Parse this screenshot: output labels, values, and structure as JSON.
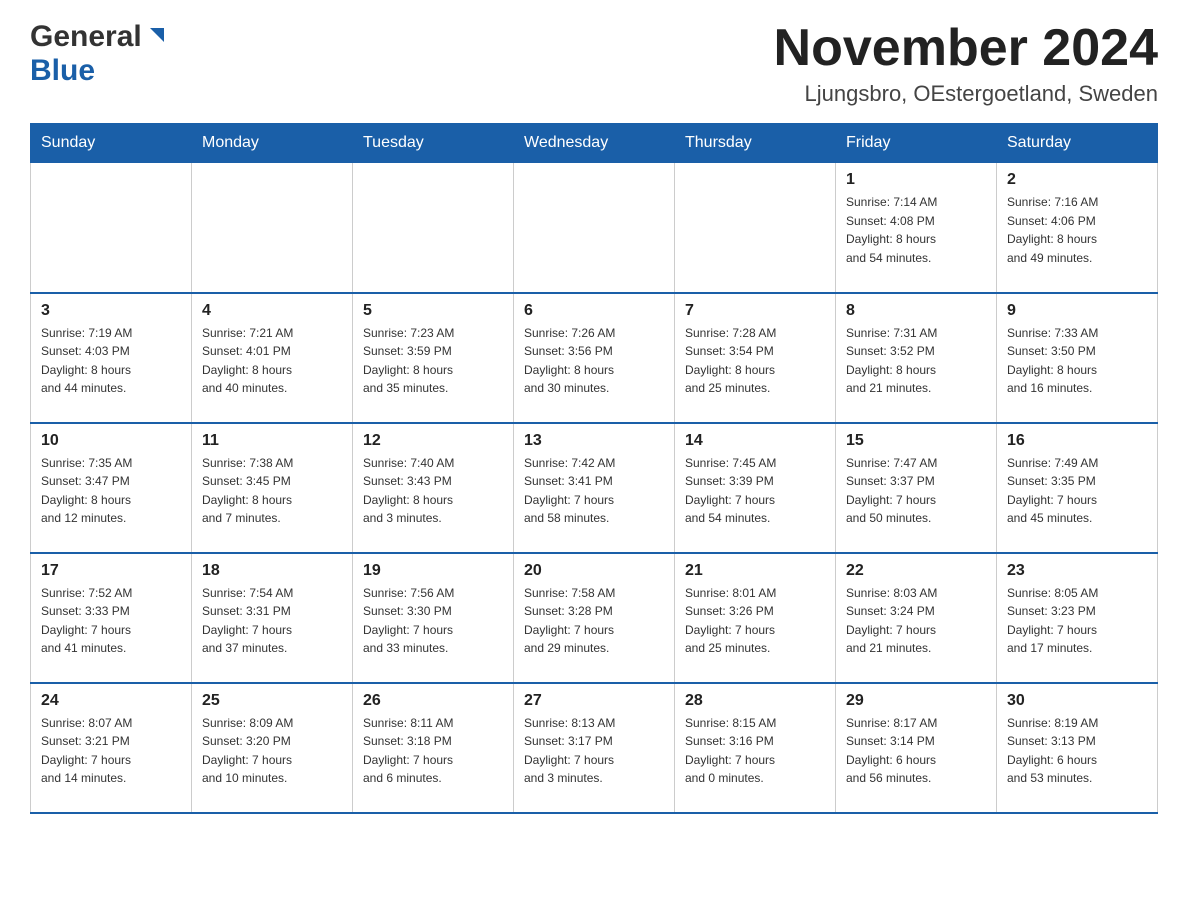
{
  "header": {
    "logo_general": "General",
    "logo_blue": "Blue",
    "month_title": "November 2024",
    "location": "Ljungsbro, OEstergoetland, Sweden"
  },
  "calendar": {
    "days_of_week": [
      "Sunday",
      "Monday",
      "Tuesday",
      "Wednesday",
      "Thursday",
      "Friday",
      "Saturday"
    ],
    "weeks": [
      {
        "days": [
          {
            "number": "",
            "info": ""
          },
          {
            "number": "",
            "info": ""
          },
          {
            "number": "",
            "info": ""
          },
          {
            "number": "",
            "info": ""
          },
          {
            "number": "",
            "info": ""
          },
          {
            "number": "1",
            "info": "Sunrise: 7:14 AM\nSunset: 4:08 PM\nDaylight: 8 hours\nand 54 minutes."
          },
          {
            "number": "2",
            "info": "Sunrise: 7:16 AM\nSunset: 4:06 PM\nDaylight: 8 hours\nand 49 minutes."
          }
        ]
      },
      {
        "days": [
          {
            "number": "3",
            "info": "Sunrise: 7:19 AM\nSunset: 4:03 PM\nDaylight: 8 hours\nand 44 minutes."
          },
          {
            "number": "4",
            "info": "Sunrise: 7:21 AM\nSunset: 4:01 PM\nDaylight: 8 hours\nand 40 minutes."
          },
          {
            "number": "5",
            "info": "Sunrise: 7:23 AM\nSunset: 3:59 PM\nDaylight: 8 hours\nand 35 minutes."
          },
          {
            "number": "6",
            "info": "Sunrise: 7:26 AM\nSunset: 3:56 PM\nDaylight: 8 hours\nand 30 minutes."
          },
          {
            "number": "7",
            "info": "Sunrise: 7:28 AM\nSunset: 3:54 PM\nDaylight: 8 hours\nand 25 minutes."
          },
          {
            "number": "8",
            "info": "Sunrise: 7:31 AM\nSunset: 3:52 PM\nDaylight: 8 hours\nand 21 minutes."
          },
          {
            "number": "9",
            "info": "Sunrise: 7:33 AM\nSunset: 3:50 PM\nDaylight: 8 hours\nand 16 minutes."
          }
        ]
      },
      {
        "days": [
          {
            "number": "10",
            "info": "Sunrise: 7:35 AM\nSunset: 3:47 PM\nDaylight: 8 hours\nand 12 minutes."
          },
          {
            "number": "11",
            "info": "Sunrise: 7:38 AM\nSunset: 3:45 PM\nDaylight: 8 hours\nand 7 minutes."
          },
          {
            "number": "12",
            "info": "Sunrise: 7:40 AM\nSunset: 3:43 PM\nDaylight: 8 hours\nand 3 minutes."
          },
          {
            "number": "13",
            "info": "Sunrise: 7:42 AM\nSunset: 3:41 PM\nDaylight: 7 hours\nand 58 minutes."
          },
          {
            "number": "14",
            "info": "Sunrise: 7:45 AM\nSunset: 3:39 PM\nDaylight: 7 hours\nand 54 minutes."
          },
          {
            "number": "15",
            "info": "Sunrise: 7:47 AM\nSunset: 3:37 PM\nDaylight: 7 hours\nand 50 minutes."
          },
          {
            "number": "16",
            "info": "Sunrise: 7:49 AM\nSunset: 3:35 PM\nDaylight: 7 hours\nand 45 minutes."
          }
        ]
      },
      {
        "days": [
          {
            "number": "17",
            "info": "Sunrise: 7:52 AM\nSunset: 3:33 PM\nDaylight: 7 hours\nand 41 minutes."
          },
          {
            "number": "18",
            "info": "Sunrise: 7:54 AM\nSunset: 3:31 PM\nDaylight: 7 hours\nand 37 minutes."
          },
          {
            "number": "19",
            "info": "Sunrise: 7:56 AM\nSunset: 3:30 PM\nDaylight: 7 hours\nand 33 minutes."
          },
          {
            "number": "20",
            "info": "Sunrise: 7:58 AM\nSunset: 3:28 PM\nDaylight: 7 hours\nand 29 minutes."
          },
          {
            "number": "21",
            "info": "Sunrise: 8:01 AM\nSunset: 3:26 PM\nDaylight: 7 hours\nand 25 minutes."
          },
          {
            "number": "22",
            "info": "Sunrise: 8:03 AM\nSunset: 3:24 PM\nDaylight: 7 hours\nand 21 minutes."
          },
          {
            "number": "23",
            "info": "Sunrise: 8:05 AM\nSunset: 3:23 PM\nDaylight: 7 hours\nand 17 minutes."
          }
        ]
      },
      {
        "days": [
          {
            "number": "24",
            "info": "Sunrise: 8:07 AM\nSunset: 3:21 PM\nDaylight: 7 hours\nand 14 minutes."
          },
          {
            "number": "25",
            "info": "Sunrise: 8:09 AM\nSunset: 3:20 PM\nDaylight: 7 hours\nand 10 minutes."
          },
          {
            "number": "26",
            "info": "Sunrise: 8:11 AM\nSunset: 3:18 PM\nDaylight: 7 hours\nand 6 minutes."
          },
          {
            "number": "27",
            "info": "Sunrise: 8:13 AM\nSunset: 3:17 PM\nDaylight: 7 hours\nand 3 minutes."
          },
          {
            "number": "28",
            "info": "Sunrise: 8:15 AM\nSunset: 3:16 PM\nDaylight: 7 hours\nand 0 minutes."
          },
          {
            "number": "29",
            "info": "Sunrise: 8:17 AM\nSunset: 3:14 PM\nDaylight: 6 hours\nand 56 minutes."
          },
          {
            "number": "30",
            "info": "Sunrise: 8:19 AM\nSunset: 3:13 PM\nDaylight: 6 hours\nand 53 minutes."
          }
        ]
      }
    ]
  }
}
